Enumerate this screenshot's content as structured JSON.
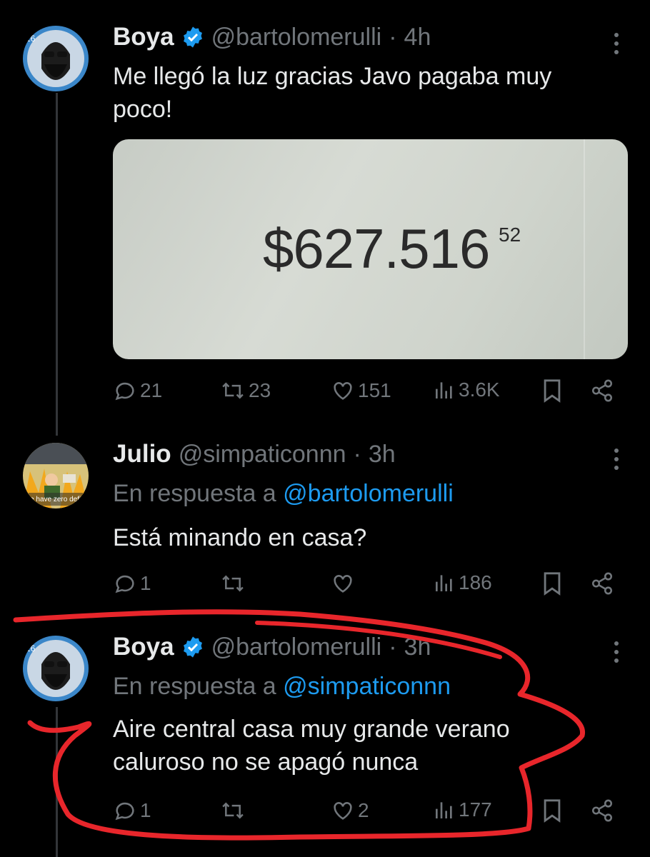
{
  "tweets": [
    {
      "name": "Boya",
      "handle": "@bartolomerulli",
      "separator": "·",
      "time": "4h",
      "text": "Me llegó la luz gracias Javo pagaba muy poco!",
      "media": {
        "amount": "$627.516",
        "cents": "52"
      },
      "actions": {
        "replies": "21",
        "retweets": "23",
        "likes": "151",
        "views": "3.6K"
      }
    },
    {
      "name": "Julio",
      "handle": "@simpaticonnn",
      "separator": "·",
      "time": "3h",
      "reply_prefix": "En respuesta a",
      "reply_to": "@bartolomerulli",
      "text": "Está minando en casa?",
      "avatar_caption": "We have zero deficit",
      "actions": {
        "replies": "1",
        "retweets": "",
        "likes": "",
        "views": "186"
      }
    },
    {
      "name": "Boya",
      "handle": "@bartolomerulli",
      "separator": "·",
      "time": "3h",
      "reply_prefix": "En respuesta a",
      "reply_to": "@simpaticonnn",
      "text": "Aire central casa muy grande verano caluroso no se apagó nunca",
      "actions": {
        "replies": "1",
        "retweets": "",
        "likes": "2",
        "views": "177"
      }
    }
  ],
  "colors": {
    "background": "#000000",
    "text": "#e7e9ea",
    "muted": "#71767b",
    "link": "#1d9bf0",
    "verified": "#1d9bf0",
    "annotation": "#e8262b"
  },
  "icons": [
    "verified-badge-icon",
    "more-icon",
    "reply-icon",
    "retweet-icon",
    "like-icon",
    "views-icon",
    "bookmark-icon",
    "share-icon"
  ]
}
